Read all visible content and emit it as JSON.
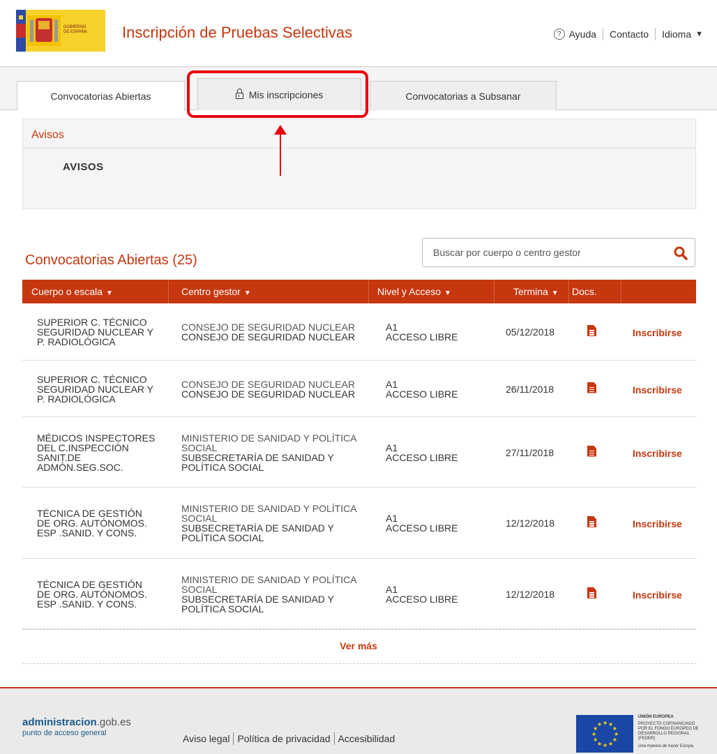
{
  "header": {
    "gov_logo_text": "GOBIERNO DE ESPAÑA",
    "title": "Inscripción de Pruebas Selectivas",
    "help": "Ayuda",
    "contact": "Contacto",
    "language": "Idioma"
  },
  "tabs": [
    {
      "label": "Convocatorias Abiertas"
    },
    {
      "label": "Mis inscripciones"
    },
    {
      "label": "Convocatorias a Subsanar"
    }
  ],
  "avisos": {
    "heading": "Avisos",
    "body": "AVISOS"
  },
  "convocatorias": {
    "title": "Convocatorias Abiertas (25)",
    "search_placeholder": "Buscar por cuerpo o centro gestor",
    "columns": {
      "cuerpo": "Cuerpo o escala",
      "centro": "Centro gestor",
      "nivel": "Nivel y Acceso",
      "termina": "Termina",
      "docs": "Docs."
    },
    "rows": [
      {
        "cuerpo": [
          "SUPERIOR C. TÉCNICO",
          "SEGURIDAD NUCLEAR Y",
          "P. RADIOLÓGICA"
        ],
        "centro_main": [
          "CONSEJO DE SEGURIDAD NUCLEAR"
        ],
        "centro_sub": [
          "CONSEJO DE SEGURIDAD NUCLEAR"
        ],
        "nivel": "A1",
        "acceso": "ACCESO LIBRE",
        "termina": "05/12/2018",
        "action": "Inscribirse"
      },
      {
        "cuerpo": [
          "SUPERIOR C. TÉCNICO",
          "SEGURIDAD NUCLEAR Y",
          "P. RADIOLÓGICA"
        ],
        "centro_main": [
          "CONSEJO DE SEGURIDAD NUCLEAR"
        ],
        "centro_sub": [
          "CONSEJO DE SEGURIDAD NUCLEAR"
        ],
        "nivel": "A1",
        "acceso": "ACCESO LIBRE",
        "termina": "26/11/2018",
        "action": "Inscribirse"
      },
      {
        "cuerpo": [
          "MÉDICOS INSPECTORES",
          "DEL C.INSPECCIÓN",
          "SANIT.DE",
          "ADMÓN.SEG.SOC."
        ],
        "centro_main": [
          "MINISTERIO DE SANIDAD Y POLÍTICA",
          "SOCIAL"
        ],
        "centro_sub": [
          "SUBSECRETARÍA DE SANIDAD Y",
          "POLÍTICA SOCIAL"
        ],
        "nivel": "A1",
        "acceso": "ACCESO LIBRE",
        "termina": "27/11/2018",
        "action": "Inscribirse"
      },
      {
        "cuerpo": [
          "TÉCNICA DE GESTIÓN",
          "DE ORG. AUTÓNOMOS.",
          "ESP .SANID. Y CONS."
        ],
        "centro_main": [
          "MINISTERIO DE SANIDAD Y POLÍTICA",
          "SOCIAL"
        ],
        "centro_sub": [
          "SUBSECRETARÍA DE SANIDAD Y",
          "POLÍTICA SOCIAL"
        ],
        "nivel": "A1",
        "acceso": "ACCESO LIBRE",
        "termina": "12/12/2018",
        "action": "Inscribirse"
      },
      {
        "cuerpo": [
          "TÉCNICA DE GESTIÓN",
          "DE ORG. AUTÓNOMOS.",
          "ESP .SANID. Y CONS."
        ],
        "centro_main": [
          "MINISTERIO DE SANIDAD Y POLÍTICA",
          "SOCIAL"
        ],
        "centro_sub": [
          "SUBSECRETARÍA DE SANIDAD Y",
          "POLÍTICA SOCIAL"
        ],
        "nivel": "A1",
        "acceso": "ACCESO LIBRE",
        "termina": "12/12/2018",
        "action": "Inscribirse"
      }
    ],
    "ver_mas": "Ver más"
  },
  "footer": {
    "logo_name": "administracion",
    "logo_domain": ".gob.es",
    "logo_tag": "punto de acceso general",
    "links": [
      "Aviso legal",
      "Política de privacidad",
      "Accesibilidad"
    ],
    "eu_title": "UNIÓN EUROPEA",
    "eu_text": "PROYECTO COFINANCIADO POR EL FONDO EUROPEO DE DESARROLLO REGIONAL (FEDER)",
    "eu_motto": "Una manera de hacer Europa"
  },
  "colors": {
    "accent": "#c6370f",
    "highlight": "#e8000d",
    "eu_blue": "#1a47a6"
  }
}
